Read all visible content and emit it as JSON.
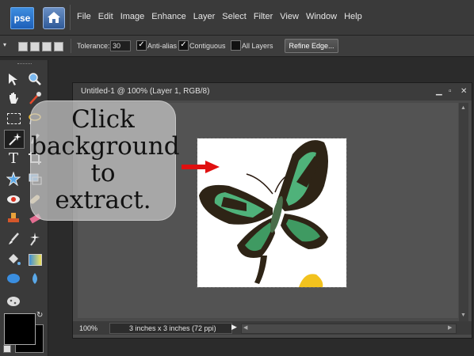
{
  "app": {
    "logo": "pse"
  },
  "menu": [
    "File",
    "Edit",
    "Image",
    "Enhance",
    "Layer",
    "Select",
    "Filter",
    "View",
    "Window",
    "Help"
  ],
  "options": {
    "tolerance_label": "Tolerance:",
    "tolerance_value": "30",
    "anti_alias_label": "Anti-alias",
    "anti_alias_checked": true,
    "contiguous_label": "Contiguous",
    "contiguous_checked": true,
    "all_layers_label": "All Layers",
    "all_layers_checked": false,
    "refine_edge_label": "Refine Edge..."
  },
  "document": {
    "title": "Untitled-1 @ 100% (Layer 1, RGB/8)",
    "zoom": "100%",
    "doc_info": "3 inches x 3 inches (72 ppi)"
  },
  "callout": {
    "line1": "Click",
    "line2": "background",
    "line3": "to",
    "line4": "extract."
  },
  "colors": {
    "arrow": "#e01010",
    "butterfly_green": "#3f9a62",
    "butterfly_dark": "#3b2a18",
    "foreground": "#000000",
    "background": "#000000"
  }
}
